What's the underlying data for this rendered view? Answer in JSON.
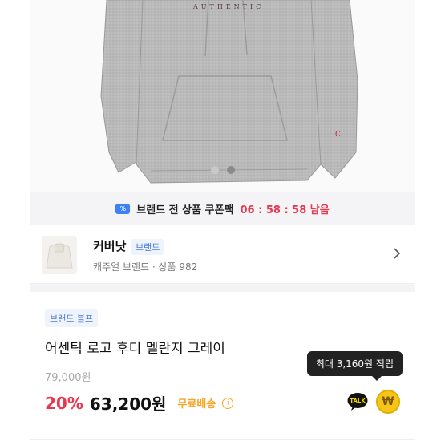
{
  "hero": {
    "print_text": "AUTHENTIC",
    "sleeve_letter": "C",
    "slides": 2,
    "active_slide": 1
  },
  "coupon": {
    "icon": "coupon-icon",
    "label": "브랜드 전 상품 쿠폰팩",
    "timer": "06 : 58 : 58 남음"
  },
  "brand": {
    "name": "커버낫",
    "tag": "브랜드",
    "subtitle": "캐주얼 브랜드 · 상품 982"
  },
  "product": {
    "badge": "브랜드 블프",
    "title": "어센틱 로고 후디 멜란지 그레이",
    "original_price": "79,000원",
    "discount": "20%",
    "price": "63,200원",
    "shipping": "무료배송",
    "points_tooltip": "최대 3,160원 적립",
    "talk_label": "TALK",
    "won_symbol": "₩"
  },
  "colors": {
    "accent_red": "#e8384f",
    "brand_blue": "#4a7dd6",
    "shipping_orange": "#f5a623"
  }
}
